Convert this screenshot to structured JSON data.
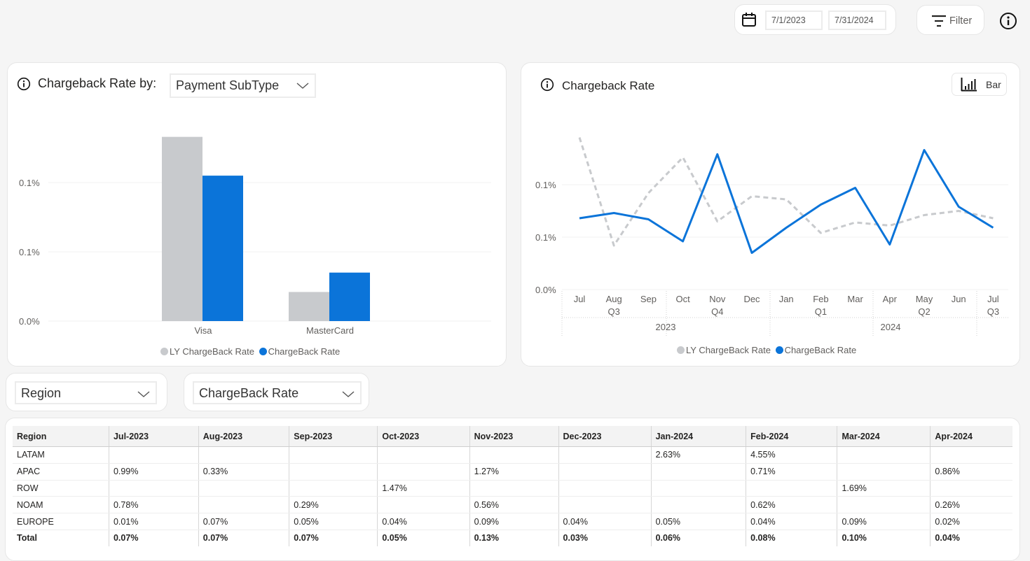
{
  "header": {
    "start_date": "7/1/2023",
    "end_date": "7/31/2024",
    "filter_label": "Filter",
    "icons": {
      "calendar": "calendar-icon",
      "filter": "filter-icon",
      "info": "info-icon"
    }
  },
  "left_panel": {
    "title": "Chargeback Rate by:",
    "dropdown_value": "Payment SubType"
  },
  "right_panel": {
    "title": "Chargeback Rate",
    "toggle_label": "Bar"
  },
  "controls": {
    "row_dropdown": "Region",
    "measure_dropdown": "ChargeBack Rate"
  },
  "colors": {
    "current": "#0b74d9",
    "last_year": "#c8cacd"
  },
  "chart_data": [
    {
      "type": "bar",
      "title": "Chargeback Rate by: Payment SubType",
      "categories": [
        "Visa",
        "MasterCard"
      ],
      "series": [
        {
          "name": "LY ChargeBack Rate",
          "values": [
            0.133,
            0.021
          ]
        },
        {
          "name": "ChargeBack Rate",
          "values": [
            0.105,
            0.035
          ]
        }
      ],
      "ytick_values": [
        0,
        0.05,
        0.1
      ],
      "ytick_labels": [
        "0.0%",
        "0.1%",
        "0.1%"
      ],
      "ylim": [
        0,
        0.14
      ],
      "xlabel": "",
      "ylabel": "",
      "unit": "%",
      "legend": "bottom-center",
      "grid": true
    },
    {
      "type": "line",
      "title": "Chargeback Rate",
      "x": [
        "Jul",
        "Aug",
        "Sep",
        "Oct",
        "Nov",
        "Dec",
        "Jan",
        "Feb",
        "Mar",
        "Apr",
        "May",
        "Jun",
        "Jul"
      ],
      "quarters": [
        {
          "label": "Q3",
          "start": 0,
          "end": 2
        },
        {
          "label": "Q4",
          "start": 3,
          "end": 5
        },
        {
          "label": "Q1",
          "start": 6,
          "end": 8
        },
        {
          "label": "Q2",
          "start": 9,
          "end": 11
        },
        {
          "label": "Q3",
          "start": 12,
          "end": 12
        }
      ],
      "years": [
        {
          "label": "2023",
          "start": 0,
          "end": 5
        },
        {
          "label": "2024",
          "start": 6,
          "end": 12
        }
      ],
      "series": [
        {
          "name": "LY ChargeBack Rate",
          "style": "dashed",
          "values": [
            0.145,
            0.042,
            0.092,
            0.126,
            0.065,
            0.089,
            0.086,
            0.054,
            0.064,
            0.061,
            0.071,
            0.075,
            0.068
          ]
        },
        {
          "name": "ChargeBack Rate",
          "style": "solid",
          "values": [
            0.068,
            0.073,
            0.067,
            0.046,
            0.129,
            0.035,
            0.059,
            0.081,
            0.097,
            0.043,
            0.133,
            0.079,
            0.059
          ]
        }
      ],
      "ytick_values": [
        0,
        0.05,
        0.1
      ],
      "ytick_labels": [
        "0.0%",
        "0.1%",
        "0.1%"
      ],
      "ylim": [
        0,
        0.15
      ],
      "xlabel": "",
      "ylabel": "",
      "unit": "%",
      "legend": "bottom-center",
      "grid": true
    }
  ],
  "table": {
    "columns": [
      "Region",
      "Jul-2023",
      "Aug-2023",
      "Sep-2023",
      "Oct-2023",
      "Nov-2023",
      "Dec-2023",
      "Jan-2024",
      "Feb-2024",
      "Mar-2024",
      "Apr-2024"
    ],
    "rows": [
      [
        "LATAM",
        "",
        "",
        "",
        "",
        "",
        "",
        "2.63%",
        "4.55%",
        "",
        ""
      ],
      [
        "APAC",
        "0.99%",
        "0.33%",
        "",
        "",
        "1.27%",
        "",
        "",
        "0.71%",
        "",
        "0.86%"
      ],
      [
        "ROW",
        "",
        "",
        "",
        "1.47%",
        "",
        "",
        "",
        "",
        "1.69%",
        ""
      ],
      [
        "NOAM",
        "0.78%",
        "",
        "0.29%",
        "",
        "0.56%",
        "",
        "",
        "0.62%",
        "",
        "0.26%"
      ],
      [
        "EUROPE",
        "0.01%",
        "0.07%",
        "0.05%",
        "0.04%",
        "0.09%",
        "0.04%",
        "0.05%",
        "0.04%",
        "0.09%",
        "0.02%"
      ]
    ],
    "total": [
      "Total",
      "0.07%",
      "0.07%",
      "0.07%",
      "0.05%",
      "0.13%",
      "0.03%",
      "0.06%",
      "0.08%",
      "0.10%",
      "0.04%"
    ]
  }
}
